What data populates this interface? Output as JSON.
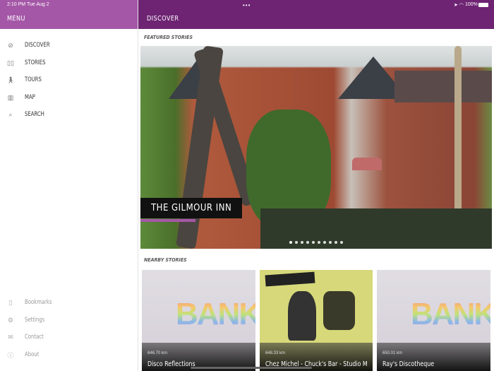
{
  "status": {
    "time": "2:10 PM",
    "date": "Tue Aug 2",
    "battery": "100%"
  },
  "sidebar": {
    "title": "MENU",
    "items": [
      {
        "label": "DISCOVER",
        "icon": "compass-icon"
      },
      {
        "label": "STORIES",
        "icon": "book-icon"
      },
      {
        "label": "TOURS",
        "icon": "walk-icon"
      },
      {
        "label": "MAP",
        "icon": "map-icon"
      },
      {
        "label": "SEARCH",
        "icon": "search-icon"
      }
    ],
    "footer": [
      {
        "label": "Bookmarks",
        "icon": "bookmark-icon"
      },
      {
        "label": "Settings",
        "icon": "gear-icon"
      },
      {
        "label": "Contact",
        "icon": "mail-icon"
      },
      {
        "label": "About",
        "icon": "info-icon"
      }
    ]
  },
  "main": {
    "title": "DISCOVER",
    "featured_label": "FEATURED STORIES",
    "featured": {
      "title": "THE GILMOUR INN",
      "pages": 10,
      "current": 0
    },
    "nearby_label": "NEARBY STORIES",
    "nearby": [
      {
        "distance": "646.70 km",
        "title": "Disco Reflections"
      },
      {
        "distance": "648.33 km",
        "title": "Chez Michel - Chuck's Bar - Studio M"
      },
      {
        "distance": "650.01 km",
        "title": "Ray's Discotheque"
      }
    ]
  },
  "colors": {
    "sidebar_header": "#a457a7",
    "main_header": "#6e2473"
  }
}
